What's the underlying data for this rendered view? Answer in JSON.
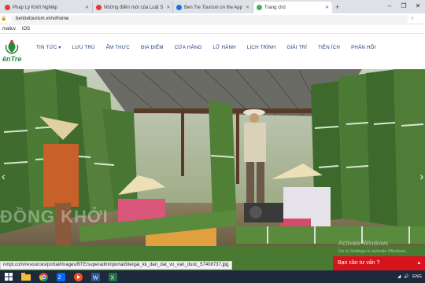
{
  "browser": {
    "tabs": [
      {
        "label": "Pháp Lý Khởi Nghiệp",
        "color": "#e53935"
      },
      {
        "label": "Những điểm mới của Luật S",
        "color": "#e53935"
      },
      {
        "label": "Ben Tre Tourism on the App",
        "color": "#1a73e8"
      },
      {
        "label": "Trang chủ",
        "color": "#4caf50"
      }
    ],
    "url": "bentretourism.vn/vi/home",
    "bookmarks": [
      "maiicv",
      "iOS"
    ]
  },
  "site": {
    "logo_text": "ênTre",
    "nav": [
      "TIN TỨC ▾",
      "LƯU TRÚ",
      "ẨM THỰC",
      "ĐỊA ĐIỂM",
      "CỬA HÀNG",
      "LỮ HÀNH",
      "LỊCH TRÌNH",
      "GIẢI TRÍ",
      "TIỆN ÍCH",
      "PHẢN HỒI"
    ]
  },
  "hero": {
    "overlay": "ĐỒNG KHỞI",
    "watermark_title": "Activate Windows",
    "watermark_sub": "Go to Settings to activate Windows."
  },
  "status_url": "nmpt.com/resources/portal/Images/BTE/superadminportal/bte/gai_kk_dan_dat_vo_van_duoc_57408737.jpg",
  "chat": {
    "label": "Bạn cần tư vấn ?",
    "arrow": "▴"
  },
  "taskbar": {
    "lang": "ENG"
  }
}
